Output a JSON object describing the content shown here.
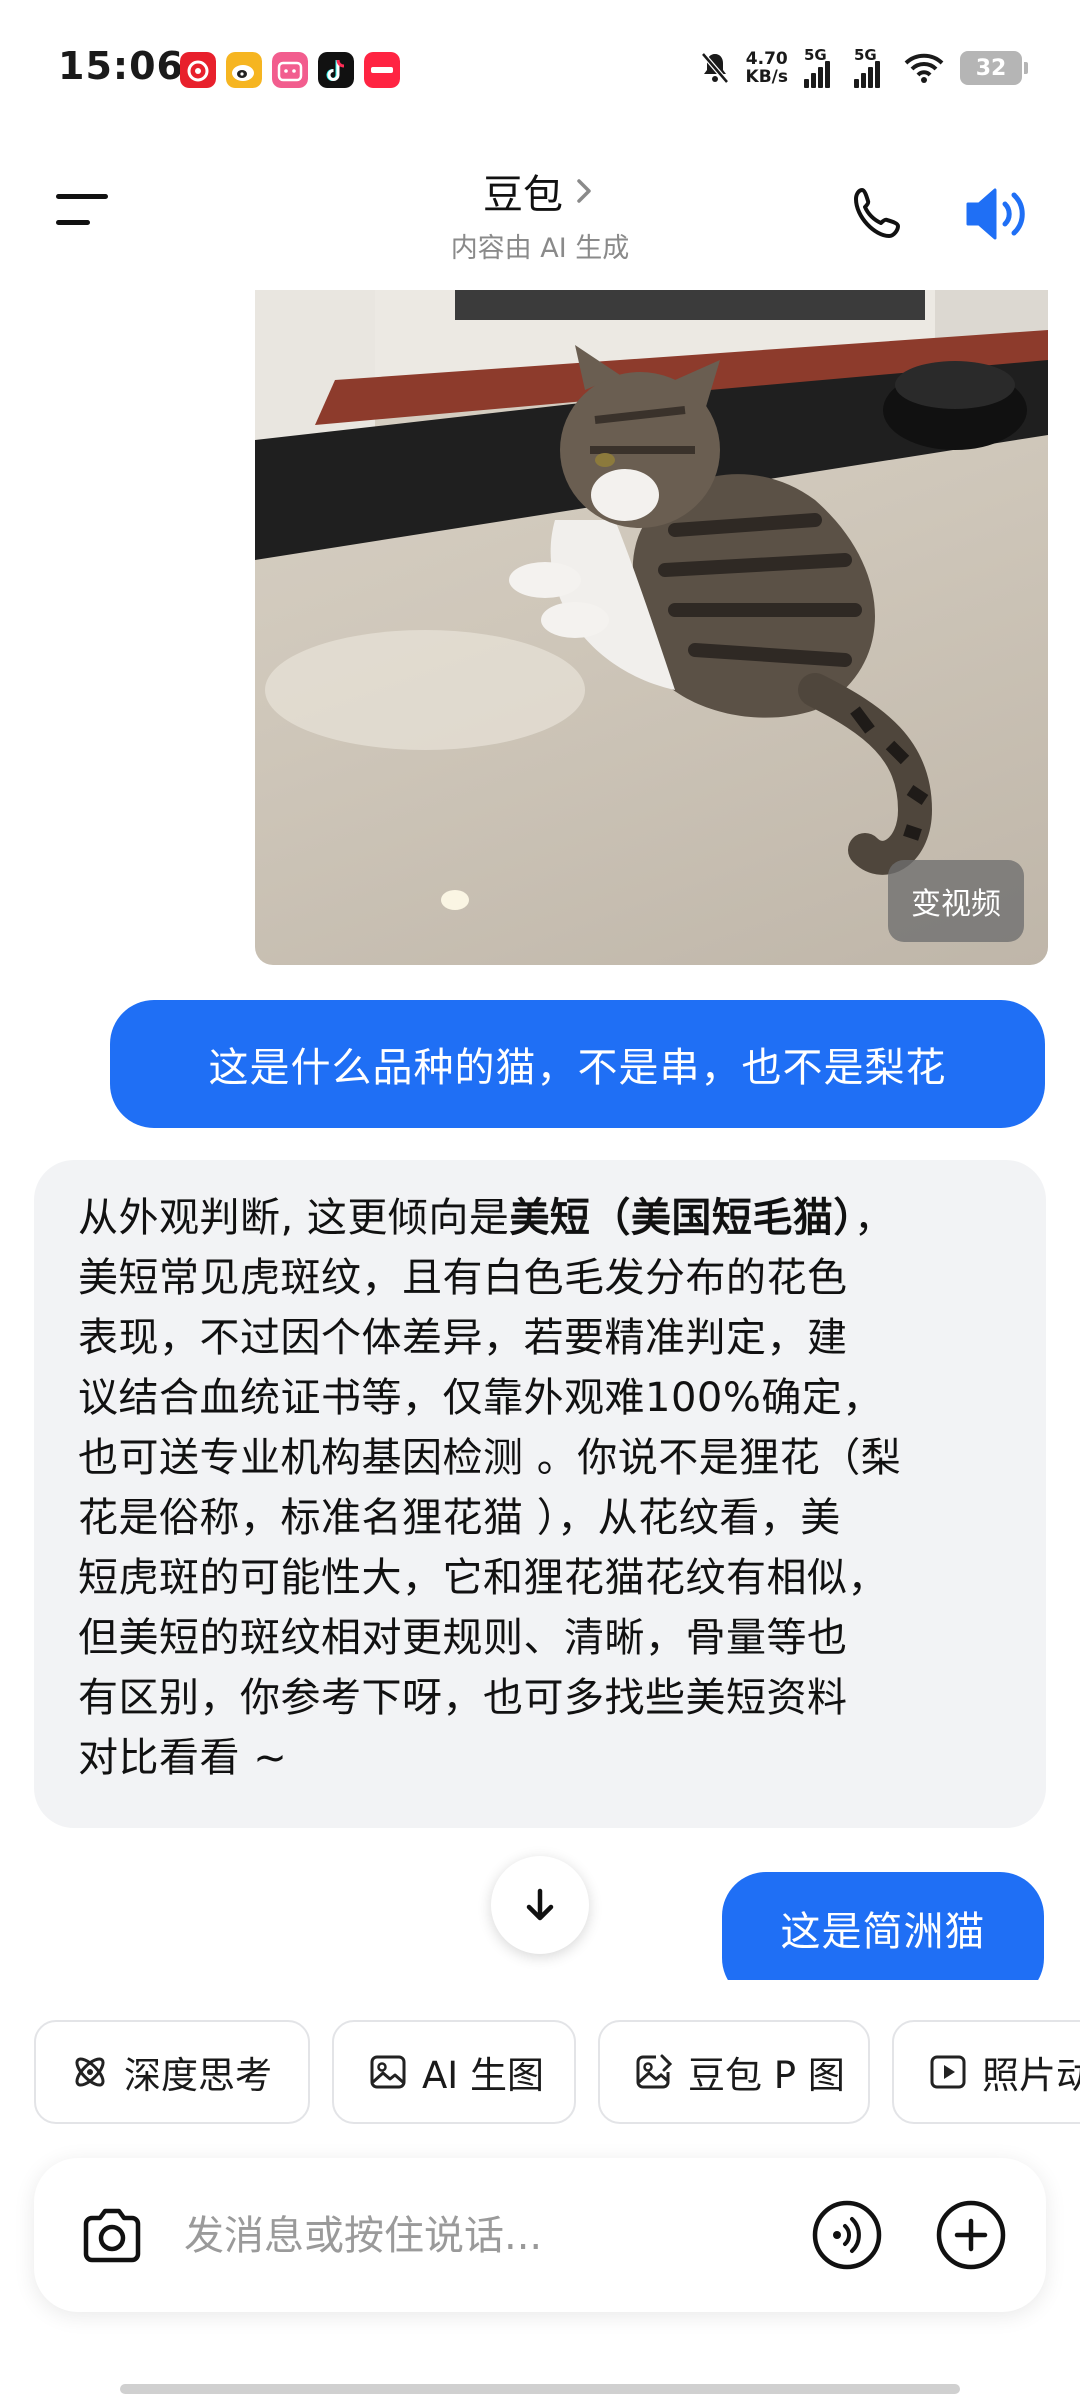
{
  "status_bar": {
    "time": "15:06",
    "net_speed_value": "4.70",
    "net_speed_unit": "KB/s",
    "sim1": "5G",
    "sim2": "5G",
    "battery": "32",
    "notification_apps": [
      {
        "icon": "netease-music-icon",
        "color": "#e8202c"
      },
      {
        "icon": "weibo-icon",
        "color": "#f6b521"
      },
      {
        "icon": "bilibili-icon",
        "color": "#f25d8e"
      },
      {
        "icon": "douyin-icon",
        "color": "#111111"
      },
      {
        "icon": "xiaohongshu-icon",
        "color": "#ff2442"
      }
    ]
  },
  "header": {
    "title": "豆包",
    "subtitle": "内容由 AI 生成"
  },
  "chat": {
    "photo_button": "变视频",
    "messages": [
      {
        "role": "user",
        "type": "image",
        "icon": "cat-photo"
      },
      {
        "role": "user",
        "text": "这是什么品种的猫，不是串，也不是梨花"
      },
      {
        "role": "assistant",
        "lines": [
          {
            "pre": "从外观判断, 这更倾向是",
            "bold": "美短（美国短毛猫）",
            "post": "，"
          },
          {
            "pre": "美短常见虎斑纹，且有白色毛发分布的花色"
          },
          {
            "pre": "表现，不过因个体差异，若要精准判定，建"
          },
          {
            "pre": "议结合血统证书等，仅靠外观难100%确定，"
          },
          {
            "pre": "也可送专业机构基因检测 。你说不是狸花（梨"
          },
          {
            "pre": "花是俗称，标准名狸花猫 ），从花纹看，美"
          },
          {
            "pre": "短虎斑的可能性大，它和狸花猫花纹有相似，"
          },
          {
            "pre": "但美短的斑纹相对更规则、清晰，骨量等也"
          },
          {
            "pre": "有区别，你参考下呀，也可多找些美短资料"
          },
          {
            "pre": "对比看看 ~"
          }
        ]
      },
      {
        "role": "user",
        "text": "这是简洲猫"
      }
    ]
  },
  "tools": [
    {
      "label": "深度思考",
      "icon": "atom-icon"
    },
    {
      "label": "AI 生图",
      "icon": "image-icon"
    },
    {
      "label": "豆包 P 图",
      "icon": "photo-edit-icon"
    },
    {
      "label": "照片动",
      "icon": "play-icon"
    }
  ],
  "input": {
    "placeholder": "发消息或按住说话...",
    "value": ""
  },
  "colors": {
    "accent": "#1f6ff5",
    "ai_bubble": "#f2f3f5"
  }
}
